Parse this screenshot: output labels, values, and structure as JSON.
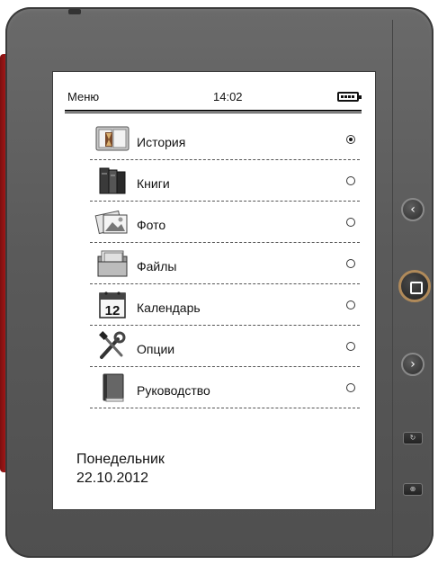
{
  "status_bar": {
    "menu_label": "Меню",
    "time": "14:02",
    "battery_icon": "battery-full-icon"
  },
  "menu": {
    "items": [
      {
        "label": "История",
        "icon": "history-icon",
        "selected": true
      },
      {
        "label": "Книги",
        "icon": "books-icon",
        "selected": false
      },
      {
        "label": "Фото",
        "icon": "photos-icon",
        "selected": false
      },
      {
        "label": "Файлы",
        "icon": "files-icon",
        "selected": false
      },
      {
        "label": "Календарь",
        "icon": "calendar-icon",
        "selected": false,
        "icon_text": "12"
      },
      {
        "label": "Опции",
        "icon": "settings-tools-icon",
        "selected": false
      },
      {
        "label": "Руководство",
        "icon": "manual-icon",
        "selected": false
      }
    ]
  },
  "footer": {
    "weekday": "Понедельник",
    "date": "22.10.2012"
  },
  "hardware_buttons": {
    "prev_glyph": "‹",
    "next_glyph": "›",
    "rotate_glyph": "↻",
    "zoom_glyph": "⊕"
  },
  "colors": {
    "device_body": "#5a5a5a",
    "side_accent": "#b21a1a",
    "center_button_ring": "#b08a5a"
  }
}
